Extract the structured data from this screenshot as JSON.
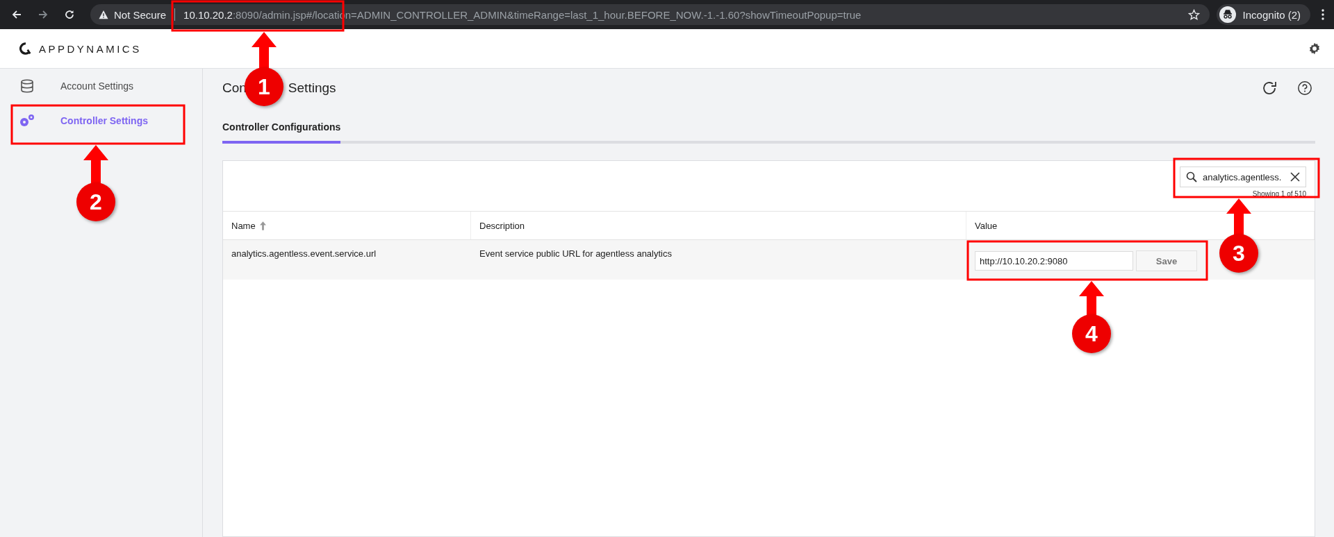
{
  "browser": {
    "security": "Not Secure",
    "url_host": "10.10.20.2",
    "url_rest": ":8090/admin.jsp#/location=ADMIN_CONTROLLER_ADMIN&timeRange=last_1_hour.BEFORE_NOW.-1.-1.60?showTimeoutPopup=true",
    "profile": "Incognito (2)"
  },
  "app": {
    "logo": "APPDYNAMICS"
  },
  "sidebar": {
    "items": [
      {
        "label": "Account Settings",
        "selected": false
      },
      {
        "label": "Controller Settings",
        "selected": true
      }
    ]
  },
  "page": {
    "title_parts": [
      "Con",
      "Settings"
    ]
  },
  "tabs": [
    {
      "label": "Controller Configurations",
      "selected": true
    }
  ],
  "search": {
    "value": "analytics.agentless."
  },
  "showing": "Showing 1 of 510",
  "table": {
    "columns": [
      {
        "label": "Name",
        "sorted": true
      },
      {
        "label": "Description",
        "sorted": false
      },
      {
        "label": "Value",
        "sorted": false
      }
    ],
    "rows": [
      {
        "name": "analytics.agentless.event.service.url",
        "description": "Event service public URL for agentless analytics",
        "value": "http://10.10.20.2:9080",
        "action": "Save"
      }
    ]
  },
  "annotations": [
    {
      "number": "1"
    },
    {
      "number": "2"
    },
    {
      "number": "3"
    },
    {
      "number": "4"
    }
  ]
}
